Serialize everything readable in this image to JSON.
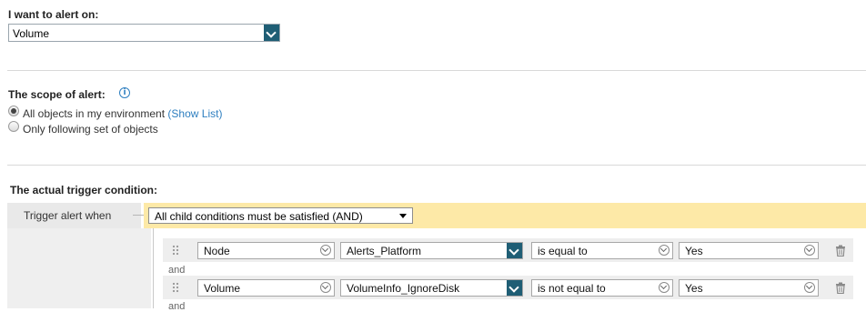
{
  "alert_on": {
    "heading": "I want to alert on:",
    "selected": "Volume"
  },
  "scope": {
    "heading": "The scope of alert:",
    "info_icon": "info-icon",
    "options": [
      {
        "label": "All objects in my environment",
        "link": "(Show List)",
        "checked": true
      },
      {
        "label": "Only following set of objects",
        "checked": false
      }
    ]
  },
  "trigger": {
    "heading": "The actual trigger condition:",
    "label": "Trigger alert when",
    "condition": "All child conditions must be satisfied (AND)",
    "rows": [
      {
        "object_type": "Node",
        "field": "Alerts_Platform",
        "operator": "is equal to",
        "value": "Yes",
        "joiner": "and"
      },
      {
        "object_type": "Volume",
        "field": "VolumeInfo_IgnoreDisk",
        "operator": "is not equal to",
        "value": "Yes",
        "joiner": "and"
      }
    ]
  },
  "colors": {
    "accent": "#1f5e75",
    "highlight_band": "#fde9a7",
    "link": "#2e7fc0"
  }
}
